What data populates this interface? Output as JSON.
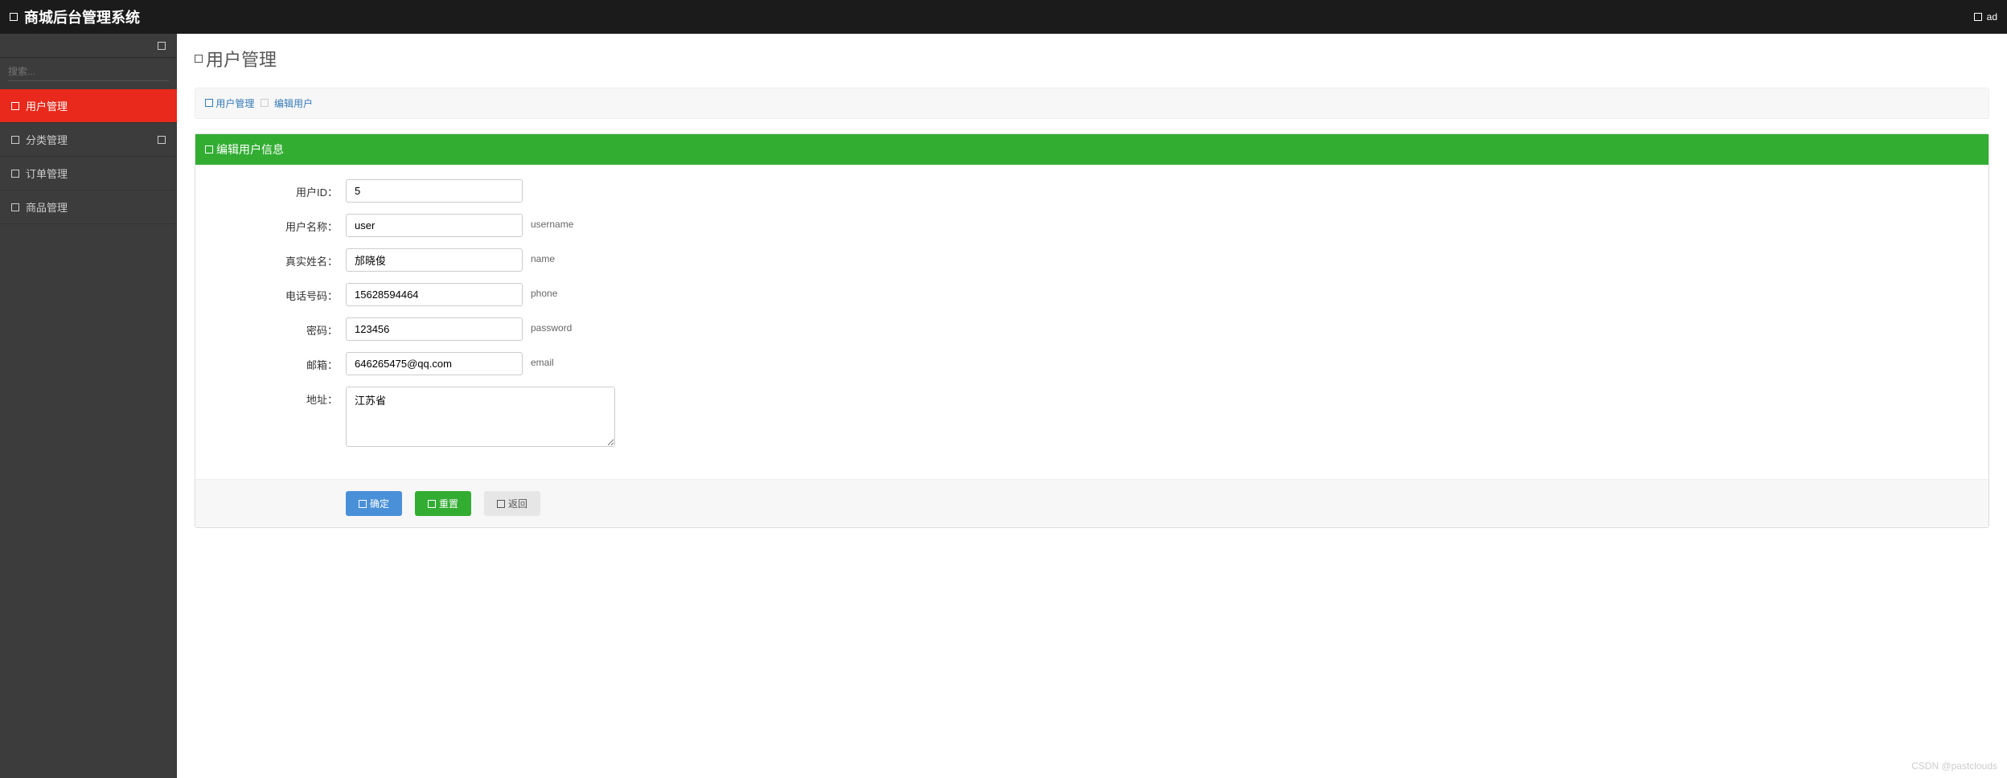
{
  "header": {
    "title": "商城后台管理系统",
    "user": "ad"
  },
  "sidebar": {
    "search_placeholder": "搜索...",
    "items": [
      {
        "label": "用户管理",
        "expandable": false
      },
      {
        "label": "分类管理",
        "expandable": true
      },
      {
        "label": "订单管理",
        "expandable": false
      },
      {
        "label": "商品管理",
        "expandable": false
      }
    ]
  },
  "page": {
    "title": "用户管理"
  },
  "breadcrumb": {
    "item1": "用户管理",
    "item2": "编辑用户"
  },
  "panel": {
    "title": "编辑用户信息"
  },
  "form": {
    "user_id": {
      "label": "用户ID：",
      "value": "5",
      "hint": ""
    },
    "username": {
      "label": "用户名称：",
      "value": "user",
      "hint": "username"
    },
    "realname": {
      "label": "真实姓名：",
      "value": "邡晓俊",
      "hint": "name"
    },
    "phone": {
      "label": "电话号码：",
      "value": "15628594464",
      "hint": "phone"
    },
    "password": {
      "label": "密码：",
      "value": "123456",
      "hint": "password"
    },
    "email": {
      "label": "邮箱：",
      "value": "646265475@qq.com",
      "hint": "email"
    },
    "address": {
      "label": "地址：",
      "value": "江苏省",
      "hint": ""
    }
  },
  "buttons": {
    "submit": "确定",
    "reset": "重置",
    "back": "返回"
  },
  "watermark": "CSDN @pastclouds"
}
